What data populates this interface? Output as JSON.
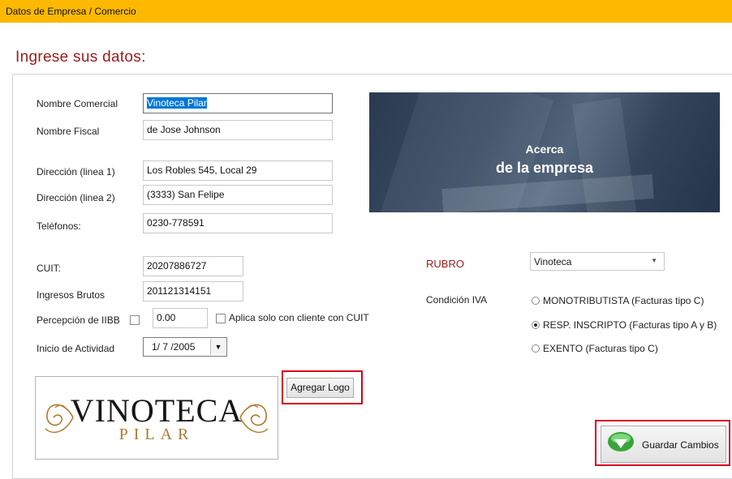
{
  "window": {
    "title": "Datos de Empresa / Comercio"
  },
  "heading": "Ingrese sus datos:",
  "form": {
    "nombre_comercial": {
      "label": "Nombre Comercial",
      "value": "Vinoteca Pilar"
    },
    "nombre_fiscal": {
      "label": "Nombre Fiscal",
      "value": "de Jose Johnson"
    },
    "direccion1": {
      "label": "Dirección (linea 1)",
      "value": "Los Robles 545, Local 29"
    },
    "direccion2": {
      "label": "Dirección (linea 2)",
      "value": "(3333) San Felipe"
    },
    "telefonos": {
      "label": "Teléfonos:",
      "value": "0230-778591"
    },
    "cuit": {
      "label": "CUIT:",
      "value": "20207886727"
    },
    "ingresos_brutos": {
      "label": "Ingresos Brutos",
      "value": "201121314151"
    },
    "percepcion": {
      "label": "Percepción de IIBB",
      "checked": false,
      "value": "0.00"
    },
    "aplica_cuit": {
      "label": "Aplica solo con cliente con CUIT",
      "checked": false
    },
    "inicio_actividad": {
      "label": "Inicio de Actividad",
      "value": "1/ 7 /2005"
    }
  },
  "banner": {
    "line1": "Acerca",
    "line2": "de la empresa"
  },
  "rubro": {
    "label": "RUBRO",
    "selected": "Vinoteca"
  },
  "condicion_iva": {
    "label": "Condición IVA",
    "options": [
      {
        "label": "MONOTRIBUTISTA (Facturas tipo C)",
        "selected": false
      },
      {
        "label": "RESP. INSCRIPTO (Facturas tipo A y B)",
        "selected": true
      },
      {
        "label": "EXENTO (Facturas tipo C)",
        "selected": false
      }
    ]
  },
  "logo": {
    "word": "VINOTECA",
    "sub": "PILAR",
    "button": "Agregar Logo"
  },
  "actions": {
    "save": "Guardar Cambios"
  },
  "colors": {
    "titlebar": "#fdb900",
    "accent_red": "#9b1b1b",
    "highlight_frame": "#d6001c",
    "selection": "#0078d7"
  }
}
